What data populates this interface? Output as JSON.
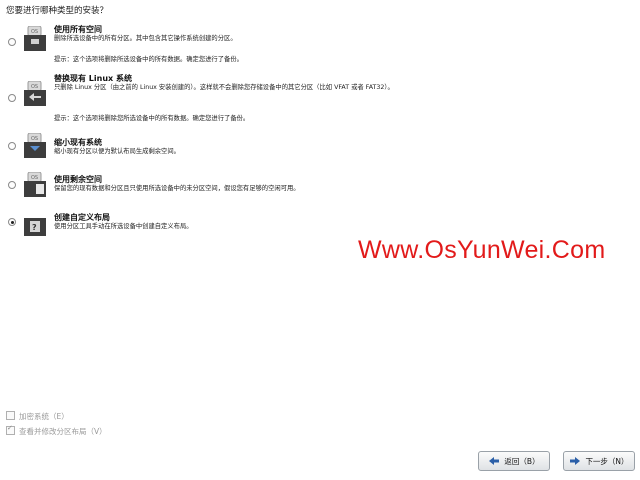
{
  "question": "您要进行哪种类型的安装？",
  "options": [
    {
      "title": "使用所有空间",
      "description": "删除所选设备中的所有分区。其中包含其它操作系统创建的分区。",
      "warning": "提示：这个选项将删除所选设备中的所有数据。确定您进行了备份。",
      "icon": "disk-fill-icon",
      "selected": false
    },
    {
      "title": "替换现有 Linux 系统",
      "description": "只删除 Linux 分区（由之前的 Linux 安装创建的）。这样就不会删除您存储设备中的其它分区（比如 VFAT 或者 FAT32）。",
      "warning": "提示：这个选项将删除您所选设备中的所有数据。确定您进行了备份。",
      "icon": "disk-replace-icon",
      "selected": false
    },
    {
      "title": "缩小现有系统",
      "description": "缩小现有分区以便为默认布局生成剩余空间。",
      "icon": "disk-shrink-icon",
      "selected": false
    },
    {
      "title": "使用剩余空间",
      "description": "保留您的现有数据和分区且只使用所选设备中的未分区空间，假设您有足够的空闲可用。",
      "icon": "disk-free-space-icon",
      "selected": false
    },
    {
      "title": "创建自定义布局",
      "description": "使用分区工具手动在所选设备中创建自定义布局。",
      "icon": "disk-custom-icon",
      "selected": true
    }
  ],
  "watermark": "Www.OsYunWei.Com",
  "encrypt_label": "加密系统（E）",
  "encrypt_checked": false,
  "review_label": "查看并修改分区布局（V）",
  "review_checked": true,
  "back_label": "返回（B）",
  "next_label": "下一步（N）",
  "colors": {
    "watermark": "#e21a1a",
    "disabled_text": "#9a9a9a"
  }
}
